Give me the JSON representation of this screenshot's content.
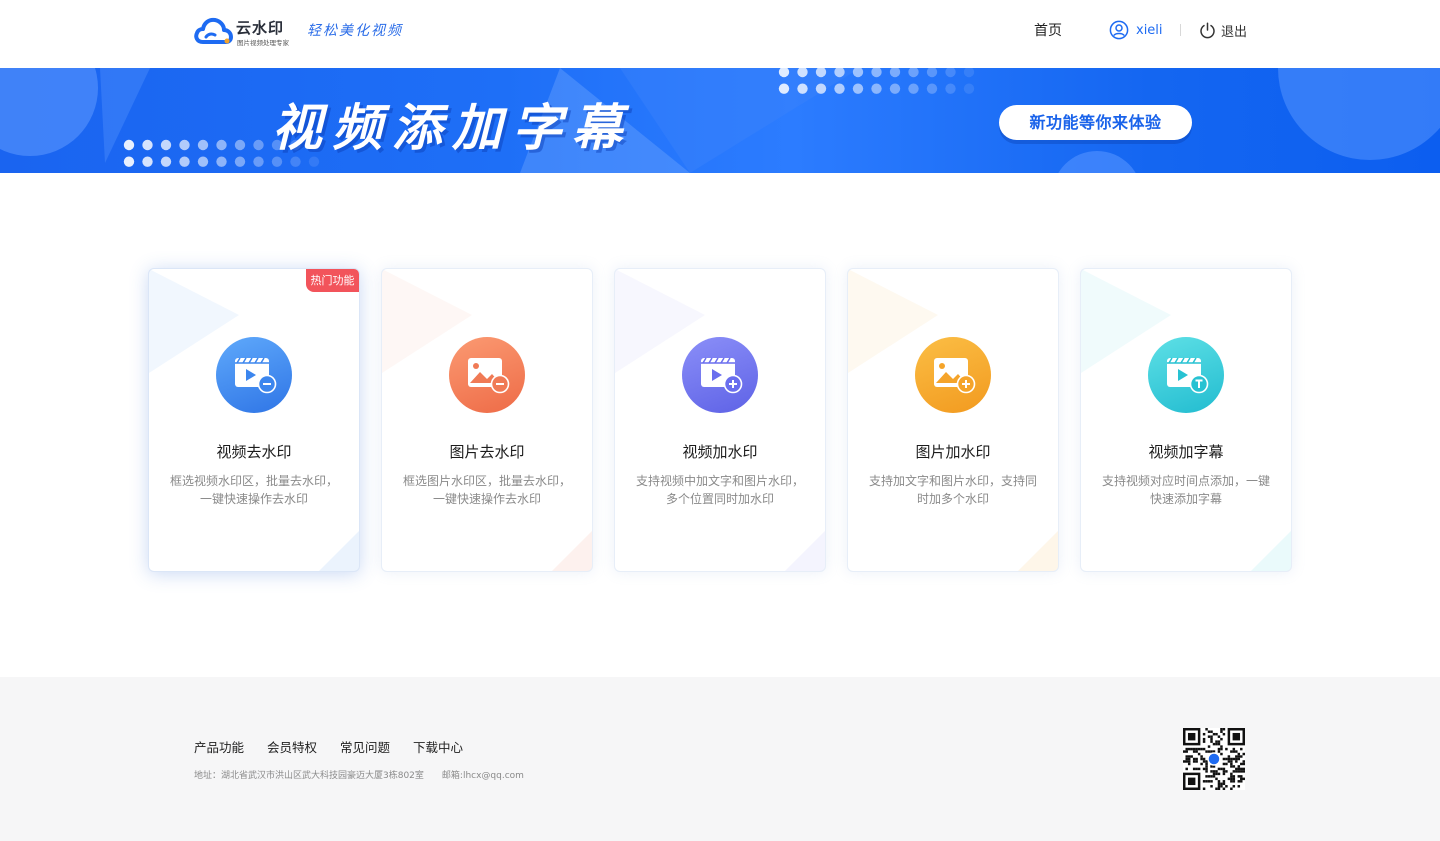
{
  "header": {
    "logo_name": "云水印",
    "logo_sub": "图片视频处理专家",
    "slogan": "轻松美化视频",
    "nav_home": "首页",
    "username": "xieli",
    "logout_label": "退出"
  },
  "banner": {
    "title": "视频添加字幕",
    "button_label": "新功能等你来体验"
  },
  "cards": [
    {
      "title": "视频去水印",
      "desc": "框选视频水印区，批量去水印，一键快速操作去水印",
      "badge": "热门功能",
      "icon": "video-remove-watermark-icon",
      "color": "#3f8cf0"
    },
    {
      "title": "图片去水印",
      "desc": "框选图片水印区，批量去水印，一键快速操作去水印",
      "icon": "image-remove-watermark-icon",
      "color": "#f07a55"
    },
    {
      "title": "视频加水印",
      "desc": "支持视频中加文字和图片水印，多个位置同时加水印",
      "icon": "video-add-watermark-icon",
      "color": "#6f74ef"
    },
    {
      "title": "图片加水印",
      "desc": "支持加文字和图片水印，支持同时加多个水印",
      "icon": "image-add-watermark-icon",
      "color": "#f5a42a"
    },
    {
      "title": "视频加字幕",
      "desc": "支持视频对应时间点添加，一键快速添加字幕",
      "icon": "video-add-subtitle-icon",
      "color": "#2fcbd6"
    }
  ],
  "footer": {
    "links": [
      "产品功能",
      "会员特权",
      "常见问题",
      "下载中心"
    ],
    "address": "地址：湖北省武汉市洪山区武大科技园豪迈大厦3栋802室",
    "email": "邮箱:lhcx@qq.com"
  },
  "colors": {
    "accent": "#1e6bf2",
    "banner_blue": "#1a64f0",
    "hot_badge": "#f2545b"
  }
}
